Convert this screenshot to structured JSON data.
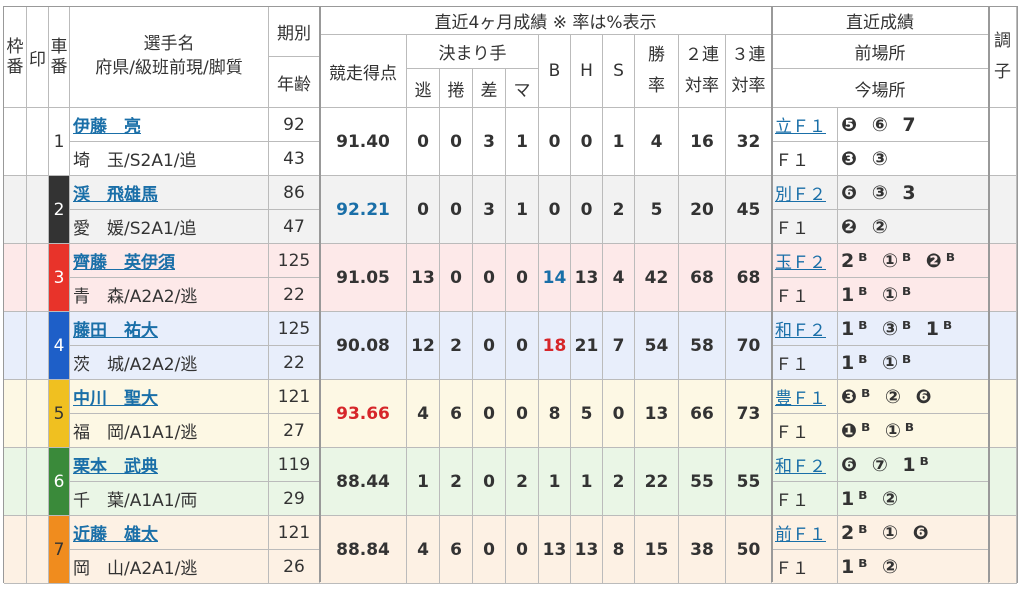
{
  "header": {
    "waku": "枠番",
    "shirushi": "印",
    "sha": "車番",
    "name1": "選手名",
    "name2": "府県/級班前現/脚質",
    "kibetsu": "期別",
    "nenrei": "年齢",
    "recent4": "直近4ヶ月成績 ※ 率は%表示",
    "tokuten": "競走得点",
    "kimarite": "決まり手",
    "nige": "逃",
    "makuri": "捲",
    "sashi": "差",
    "ma": "マ",
    "b": "B",
    "h": "H",
    "s": "S",
    "shoritsu": "勝率",
    "nirenritsu": "２連対率",
    "sanrenritsu": "３連対率",
    "recent": "直近成績",
    "zenba": "前場所",
    "konba": "今場所",
    "choshi": "調子"
  },
  "rows": [
    {
      "waku": "",
      "waku_color": "#ffffff",
      "waku_text": "#333",
      "sha": "1",
      "name": "伊藤　亮",
      "info": "埼　玉/S2A1/追",
      "ki": "92",
      "age": "43",
      "score": "91.40",
      "score_color": "#333",
      "nige": "0",
      "makuri": "0",
      "sashi": "3",
      "ma": "1",
      "b": "0",
      "b_color": "#333",
      "h": "0",
      "s": "1",
      "win": "4",
      "ren2": "16",
      "ren3": "32",
      "prev_label": "立Ｆ１",
      "prev": "❺ ⑥ 7",
      "cur_label": "Ｆ１",
      "cur": "❸ ③",
      "bg": "#ffffff"
    },
    {
      "waku": "2",
      "waku_color": "#333333",
      "waku_text": "#fff",
      "sha": "2",
      "name": "渓　飛雄馬",
      "info": "愛　媛/S2A1/追",
      "ki": "86",
      "age": "47",
      "score": "92.21",
      "score_color": "#1a6fa8",
      "nige": "0",
      "makuri": "0",
      "sashi": "3",
      "ma": "1",
      "b": "0",
      "b_color": "#333",
      "h": "0",
      "s": "2",
      "win": "5",
      "ren2": "20",
      "ren3": "45",
      "prev_label": "別Ｆ２",
      "prev": "❻ ③ 3",
      "cur_label": "Ｆ１",
      "cur": "❷ ②",
      "bg": "#f2f2f2"
    },
    {
      "waku": "3",
      "waku_color": "#e8332a",
      "waku_text": "#fff",
      "sha": "3",
      "name": "齊藤　英伊須",
      "info": "青　森/A2A2/逃",
      "ki": "125",
      "age": "22",
      "score": "91.05",
      "score_color": "#333",
      "nige": "13",
      "makuri": "0",
      "sashi": "0",
      "ma": "0",
      "b": "14",
      "b_color": "#1a6fa8",
      "h": "13",
      "s": "4",
      "win": "42",
      "ren2": "68",
      "ren3": "68",
      "prev_label": "玉Ｆ２",
      "prev": "2ᴮ ①ᴮ ❷ᴮ",
      "cur_label": "Ｆ１",
      "cur": "1ᴮ ①ᴮ",
      "bg": "#fde9e9"
    },
    {
      "waku": "4",
      "waku_color": "#1e5fc8",
      "waku_text": "#fff",
      "sha": "4",
      "name": "藤田　祐大",
      "info": "茨　城/A2A2/逃",
      "ki": "125",
      "age": "22",
      "score": "90.08",
      "score_color": "#333",
      "nige": "12",
      "makuri": "2",
      "sashi": "0",
      "ma": "0",
      "b": "18",
      "b_color": "#d6262a",
      "h": "21",
      "s": "7",
      "win": "54",
      "ren2": "58",
      "ren3": "70",
      "prev_label": "和Ｆ２",
      "prev": "1ᴮ ③ᴮ 1ᴮ",
      "cur_label": "Ｆ１",
      "cur": "1ᴮ ①ᴮ",
      "bg": "#e8eefb"
    },
    {
      "waku": "5",
      "waku_color": "#f0c020",
      "waku_text": "#333",
      "sha": "5",
      "name": "中川　聖大",
      "info": "福　岡/A1A1/逃",
      "ki": "121",
      "age": "27",
      "score": "93.66",
      "score_color": "#d6262a",
      "nige": "4",
      "makuri": "6",
      "sashi": "0",
      "ma": "0",
      "b": "8",
      "b_color": "#333",
      "h": "5",
      "s": "0",
      "win": "13",
      "ren2": "66",
      "ren3": "73",
      "prev_label": "豊Ｆ１",
      "prev": "❸ᴮ ② ❻",
      "cur_label": "Ｆ１",
      "cur": "❶ᴮ ①ᴮ",
      "bg": "#fdf8e4"
    },
    {
      "waku": "6",
      "waku_color": "#3a8a3a",
      "waku_text": "#fff",
      "sha": "6",
      "name": "栗本　武典",
      "info": "千　葉/A1A1/両",
      "ki": "119",
      "age": "29",
      "score": "88.44",
      "score_color": "#333",
      "nige": "1",
      "makuri": "2",
      "sashi": "0",
      "ma": "2",
      "b": "1",
      "b_color": "#333",
      "h": "1",
      "s": "2",
      "win": "22",
      "ren2": "55",
      "ren3": "55",
      "prev_label": "和Ｆ２",
      "prev": "❻ ⑦ 1ᴮ",
      "cur_label": "Ｆ１",
      "cur": "1ᴮ ②",
      "bg": "#eaf6e6"
    },
    {
      "waku": "7",
      "waku_color": "#f08c1e",
      "waku_text": "#333",
      "sha": "7",
      "name": "近藤　雄太",
      "info": "岡　山/A2A1/逃",
      "ki": "121",
      "age": "26",
      "score": "88.84",
      "score_color": "#333",
      "nige": "4",
      "makuri": "6",
      "sashi": "0",
      "ma": "0",
      "b": "13",
      "b_color": "#333",
      "h": "13",
      "s": "8",
      "win": "15",
      "ren2": "38",
      "ren3": "50",
      "prev_label": "前Ｆ１",
      "prev": "2ᴮ ① ❻",
      "cur_label": "Ｆ１",
      "cur": "1ᴮ ②",
      "bg": "#fdf1e4"
    }
  ]
}
